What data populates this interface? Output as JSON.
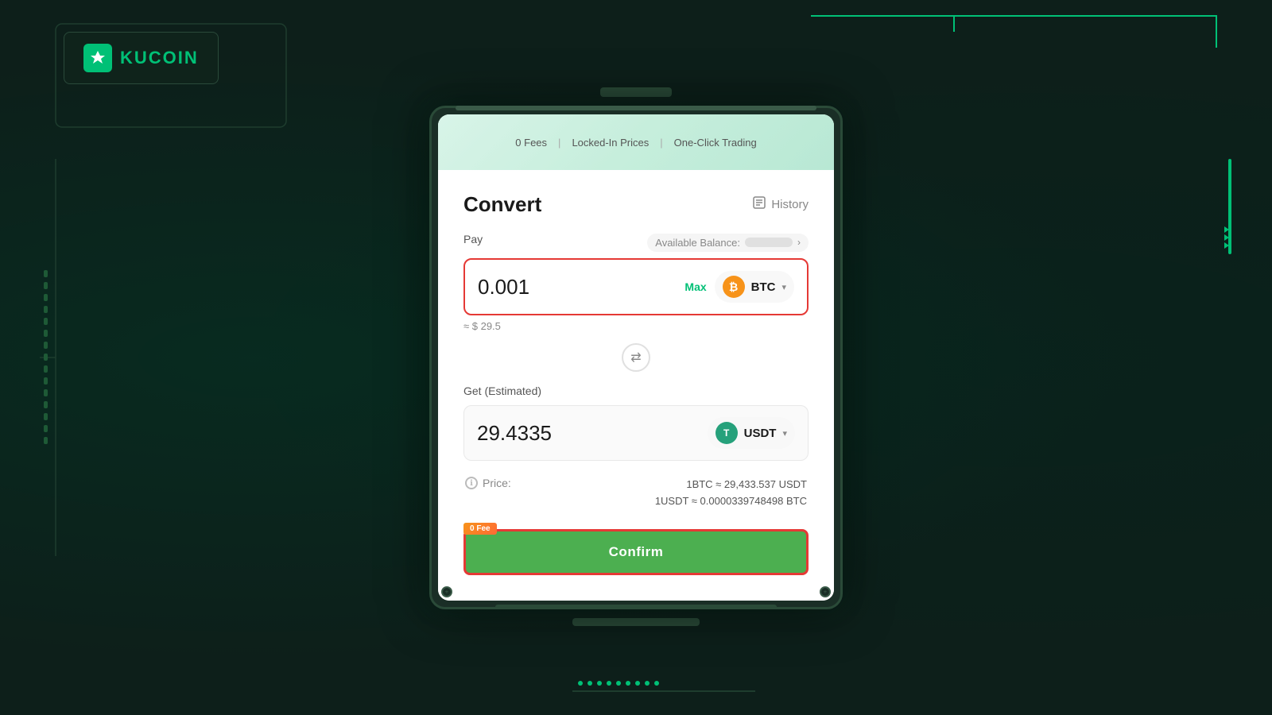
{
  "background": {
    "color": "#0d1f1a"
  },
  "logo": {
    "text": "KUCOIN",
    "icon_symbol": "◈"
  },
  "banner": {
    "items": [
      "0 Fees",
      "Locked-In Prices",
      "One-Click Trading"
    ],
    "separator": "|"
  },
  "convert": {
    "title": "Convert",
    "history_label": "History",
    "pay_label": "Pay",
    "available_balance_label": "Available Balance:",
    "pay_amount": "0.001",
    "max_label": "Max",
    "pay_currency": "BTC",
    "usd_equiv": "≈ $ 29.5",
    "get_label": "Get (Estimated)",
    "get_amount": "29.4335",
    "get_currency": "USDT",
    "price_label": "Price:",
    "price_line1": "1BTC ≈ 29,433.537 USDT",
    "price_line2": "1USDT ≈ 0.0000339748498 BTC",
    "fee_badge": "0 Fee",
    "confirm_label": "Confirm"
  }
}
